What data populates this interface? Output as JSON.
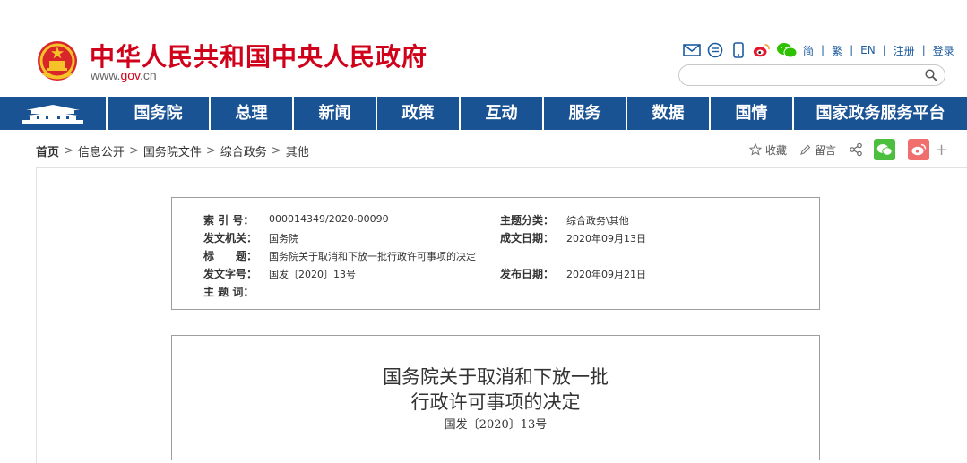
{
  "header": {
    "site_title": "中华人民共和国中央人民政府",
    "url_prefix": "www.",
    "url_gov": "gov",
    "url_suffix": ".cn",
    "brand_color": "#d0021b"
  },
  "top_tools": {
    "icons": [
      "mail-icon",
      "chat-bubble-icon",
      "mobile-icon",
      "weibo-icon",
      "wechat-icon"
    ],
    "links": [
      "简",
      "繁",
      "EN",
      "注册",
      "登录"
    ],
    "search_placeholder": ""
  },
  "nav": {
    "color": "#1a5394",
    "items": [
      "国务院",
      "总理",
      "新闻",
      "政策",
      "互动",
      "服务",
      "数据",
      "国情",
      "国家政务服务平台"
    ]
  },
  "breadcrumb": {
    "items": [
      "首页",
      "信息公开",
      "国务院文件",
      "综合政务",
      "其他"
    ],
    "separator": ">"
  },
  "page_tools": {
    "favorite": "收藏",
    "comment": "留言"
  },
  "meta": {
    "index_label": "索 引 号：",
    "index_value": "000014349/2020-00090",
    "topic_label": "主题分类：",
    "topic_value": "综合政务\\其他",
    "issuer_label": "发文机关：",
    "issuer_value": "国务院",
    "written_label": "成文日期：",
    "written_value": "2020年09月13日",
    "title_label": "标　　题：",
    "title_value": "国务院关于取消和下放一批行政许可事项的决定",
    "doc_no_label": "发文字号：",
    "doc_no_value": "国发〔2020〕13号",
    "publish_label": "发布日期：",
    "publish_value": "2020年09月21日",
    "keywords_label": "主 题 词：",
    "keywords_value": ""
  },
  "document": {
    "title_line1": "国务院关于取消和下放一批",
    "title_line2": "行政许可事项的决定",
    "number": "国发〔2020〕13号"
  }
}
